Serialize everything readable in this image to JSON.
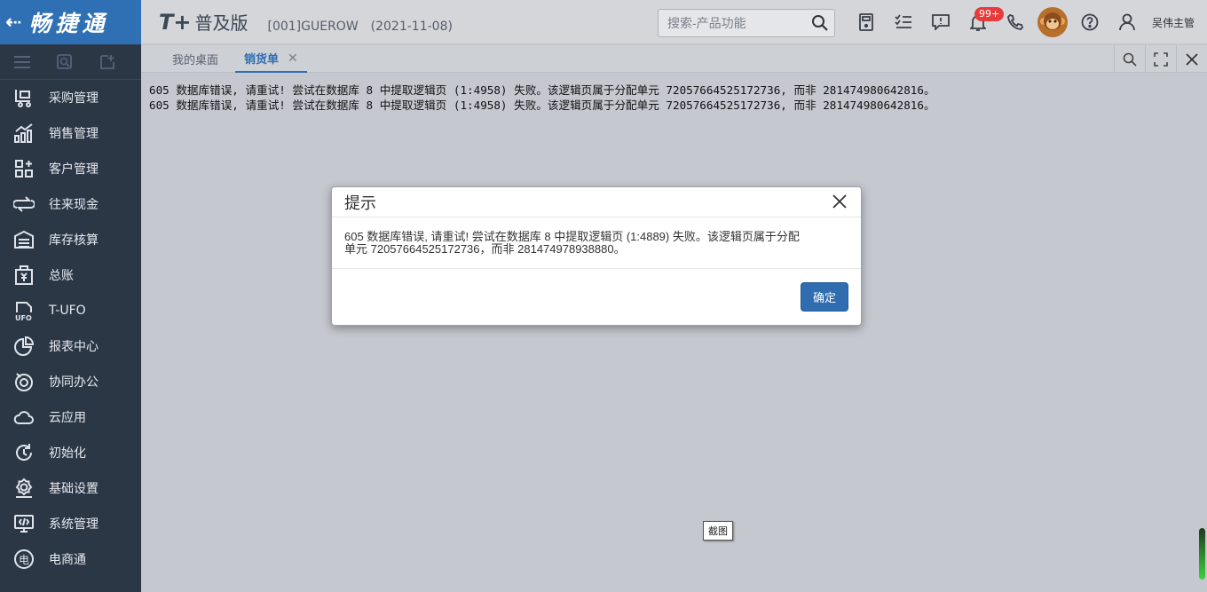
{
  "app": {
    "logo_text": "畅捷通",
    "back_glyph": "⇠"
  },
  "header": {
    "product": "T+",
    "edition": "普及版",
    "account": "[001]GUEROW　(2021-11-08)",
    "search_placeholder": "搜索-产品功能",
    "notification_badge": "99+",
    "username": "吴伟主管"
  },
  "sidebar": {
    "items": [
      {
        "label": "采购管理",
        "icon": "purchase-icon"
      },
      {
        "label": "销售管理",
        "icon": "sales-icon"
      },
      {
        "label": "客户管理",
        "icon": "customer-icon"
      },
      {
        "label": "往来现金",
        "icon": "cash-icon"
      },
      {
        "label": "库存核算",
        "icon": "inventory-icon"
      },
      {
        "label": "总账",
        "icon": "ledger-icon"
      },
      {
        "label": "T-UFO",
        "icon": "ufo-icon"
      },
      {
        "label": "报表中心",
        "icon": "report-icon"
      },
      {
        "label": "协同办公",
        "icon": "collab-icon"
      },
      {
        "label": "云应用",
        "icon": "cloud-icon"
      },
      {
        "label": "初始化",
        "icon": "init-icon"
      },
      {
        "label": "基础设置",
        "icon": "settings-icon"
      },
      {
        "label": "系统管理",
        "icon": "system-icon"
      },
      {
        "label": "电商通",
        "icon": "ecommerce-icon"
      }
    ]
  },
  "tabs": [
    {
      "label": "我的桌面",
      "active": false
    },
    {
      "label": "销货单",
      "active": true,
      "close": "✕"
    }
  ],
  "content": {
    "error_lines": [
      "605 数据库错误, 请重试! 尝试在数据库 8 中提取逻辑页 (1:4958) 失败。该逻辑页属于分配单元 72057664525172736, 而非 281474980642816。",
      "605 数据库错误, 请重试! 尝试在数据库 8 中提取逻辑页 (1:4958) 失败。该逻辑页属于分配单元 72057664525172736, 而非 281474980642816。"
    ]
  },
  "dialog": {
    "title": "提示",
    "line1": "605 数据库错误, 请重试! 尝试在数据库 8 中提取逻辑页 (1:4889) 失败。该逻辑页属于分配",
    "line2": "单元 72057664525172736，而非 281474978938880。",
    "ok_label": "确定"
  },
  "tooltip": {
    "label": "截图"
  },
  "colors": {
    "brand": "#2f70b5",
    "sidebar": "#2c3746",
    "badge": "#e83a3a",
    "button": "#2f6db0"
  }
}
